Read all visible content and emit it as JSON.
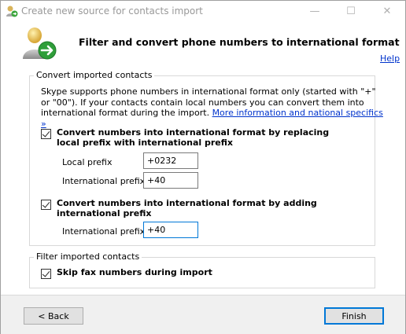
{
  "window": {
    "title": "Create new source for contacts import",
    "minimize_glyph": "—",
    "maximize_glyph": "☐",
    "close_glyph": "✕"
  },
  "header": {
    "title": "Filter and convert phone numbers to international format",
    "help_label": "Help",
    "icon": "user-import-icon"
  },
  "convert_group": {
    "legend": "Convert imported contacts",
    "description": "Skype supports phone numbers in international format only (started with \"+\" or \"00\"). If your contacts contain local numbers you can convert them into international format during the import.",
    "more_info_link": "More information and national specifics »",
    "option_replace": {
      "label": "Convert numbers into international format by replacing local prefix with international prefix",
      "checked": true,
      "local_prefix_label": "Local prefix",
      "local_prefix_value": "+0232",
      "international_prefix_label": "International prefix",
      "international_prefix_value": "+40"
    },
    "option_add": {
      "label": "Convert numbers into international format by adding international prefix",
      "checked": true,
      "international_prefix_label": "International prefix",
      "international_prefix_value": "+40"
    }
  },
  "filter_group": {
    "legend": "Filter imported contacts",
    "skip_fax": {
      "label": "Skip fax numbers during import",
      "checked": true
    }
  },
  "footer": {
    "back_label": "< Back",
    "finish_label": "Finish"
  },
  "colors": {
    "link": "#0033cc",
    "focus_border": "#0078d7",
    "footer_bg": "#f0f0f0"
  }
}
